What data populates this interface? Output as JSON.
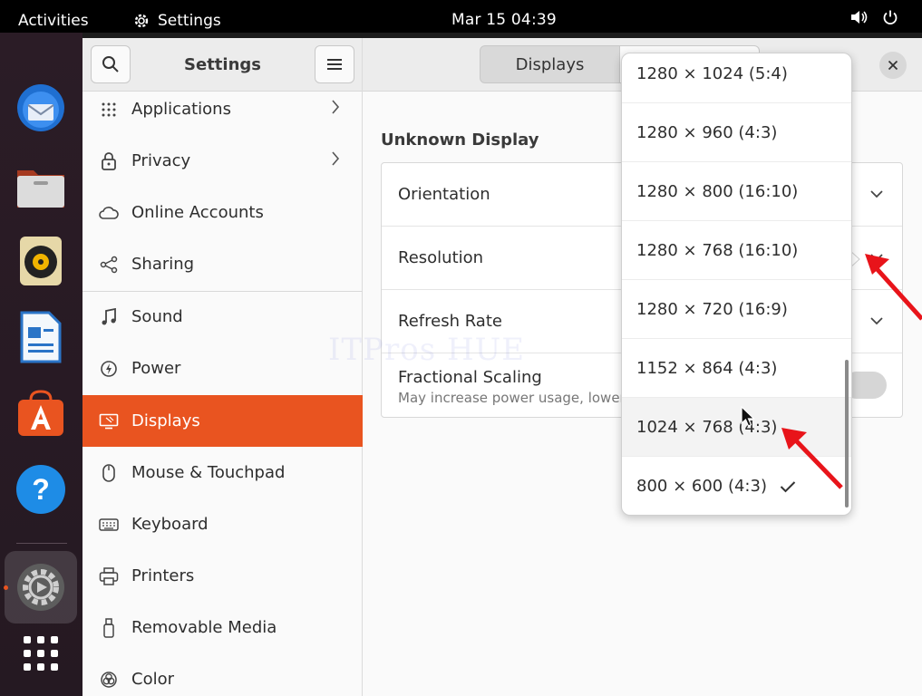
{
  "topbar": {
    "activities": "Activities",
    "app_name": "Settings",
    "datetime": "Mar 15  04:39"
  },
  "dock": {
    "apps": [
      "Thunderbird Mail",
      "Files",
      "Rhythmbox",
      "LibreOffice Writer",
      "Ubuntu Software",
      "Help",
      "Settings",
      "Show Applications"
    ]
  },
  "sidebar": {
    "title": "Settings",
    "items": [
      {
        "label": "Applications",
        "icon": "grid-icon",
        "chevron": true
      },
      {
        "label": "Privacy",
        "icon": "lock-icon",
        "chevron": true
      },
      {
        "label": "Online Accounts",
        "icon": "cloud-icon",
        "chevron": false
      },
      {
        "label": "Sharing",
        "icon": "share-icon",
        "chevron": false
      },
      {
        "label": "Sound",
        "icon": "music-note-icon",
        "chevron": false
      },
      {
        "label": "Power",
        "icon": "power-icon",
        "chevron": false
      },
      {
        "label": "Displays",
        "icon": "display-icon",
        "chevron": false,
        "active": true
      },
      {
        "label": "Mouse & Touchpad",
        "icon": "mouse-icon",
        "chevron": false
      },
      {
        "label": "Keyboard",
        "icon": "keyboard-icon",
        "chevron": false
      },
      {
        "label": "Printers",
        "icon": "printer-icon",
        "chevron": false
      },
      {
        "label": "Removable Media",
        "icon": "usb-icon",
        "chevron": false
      },
      {
        "label": "Color",
        "icon": "color-icon",
        "chevron": false
      }
    ]
  },
  "main": {
    "tabs": [
      {
        "label": "Displays",
        "selected": true
      }
    ],
    "section_title": "Unknown Display",
    "rows": [
      {
        "label": "Orientation",
        "sub": ""
      },
      {
        "label": "Resolution",
        "sub": ""
      },
      {
        "label": "Refresh Rate",
        "sub": ""
      },
      {
        "label": "Fractional Scaling",
        "sub": "May increase power usage, lower sp"
      }
    ]
  },
  "resolution_dropdown": {
    "options": [
      {
        "label": "1280 × 1024 (5:4)",
        "selected": false
      },
      {
        "label": "1280 × 960 (4:3)",
        "selected": false
      },
      {
        "label": "1280 × 800 (16:10)",
        "selected": false
      },
      {
        "label": "1280 × 768 (16:10)",
        "selected": false
      },
      {
        "label": "1280 × 720 (16:9)",
        "selected": false
      },
      {
        "label": "1152 × 864 (4:3)",
        "selected": false
      },
      {
        "label": "1024 × 768 (4:3)",
        "selected": false,
        "hovered": true
      },
      {
        "label": "800 × 600 (4:3)",
        "selected": true
      }
    ]
  },
  "watermark": "ITPros HUE",
  "colors": {
    "accent": "#e95420",
    "annotation_arrow": "#e8141a"
  }
}
